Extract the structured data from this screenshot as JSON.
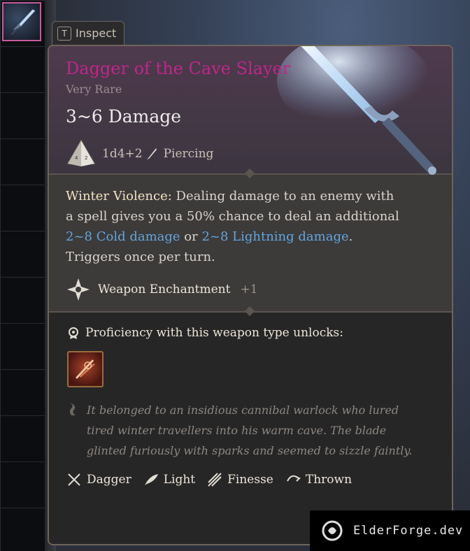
{
  "inspect": {
    "key": "T",
    "label": "Inspect"
  },
  "item": {
    "name": "Dagger of the Cave Slayer",
    "rarity": "Very Rare",
    "damage": "3~6 Damage",
    "dice": "1d4+2",
    "damage_type": "Piercing",
    "ability_name": "Winter Violence:",
    "ability_text_1": " Dealing damage to an enemy with a spell gives you a 50% chance to deal an additional ",
    "cold_damage": "2~8 Cold damage",
    "or_text": " or ",
    "lightning_damage": "2~8 Lightning damage",
    "ability_text_2": ". Triggers once per turn.",
    "enchantment_label": "Weapon Enchantment",
    "enchantment_value": "+1",
    "proficiency_label": "Proficiency with this weapon type unlocks:",
    "lore": "It belonged to an insidious cannibal warlock who lured tired winter travellers into his warm cave. The blade glinted furiously with sparks and seemed to sizzle faintly.",
    "properties": [
      "Dagger",
      "Light",
      "Finesse",
      "Thrown"
    ]
  },
  "colors": {
    "rarity_accent": "#c0268a",
    "damage_highlight": "#5fa6e0",
    "slot_border": "#c65a9a"
  },
  "watermark": {
    "text": "ElderForge.dev"
  }
}
